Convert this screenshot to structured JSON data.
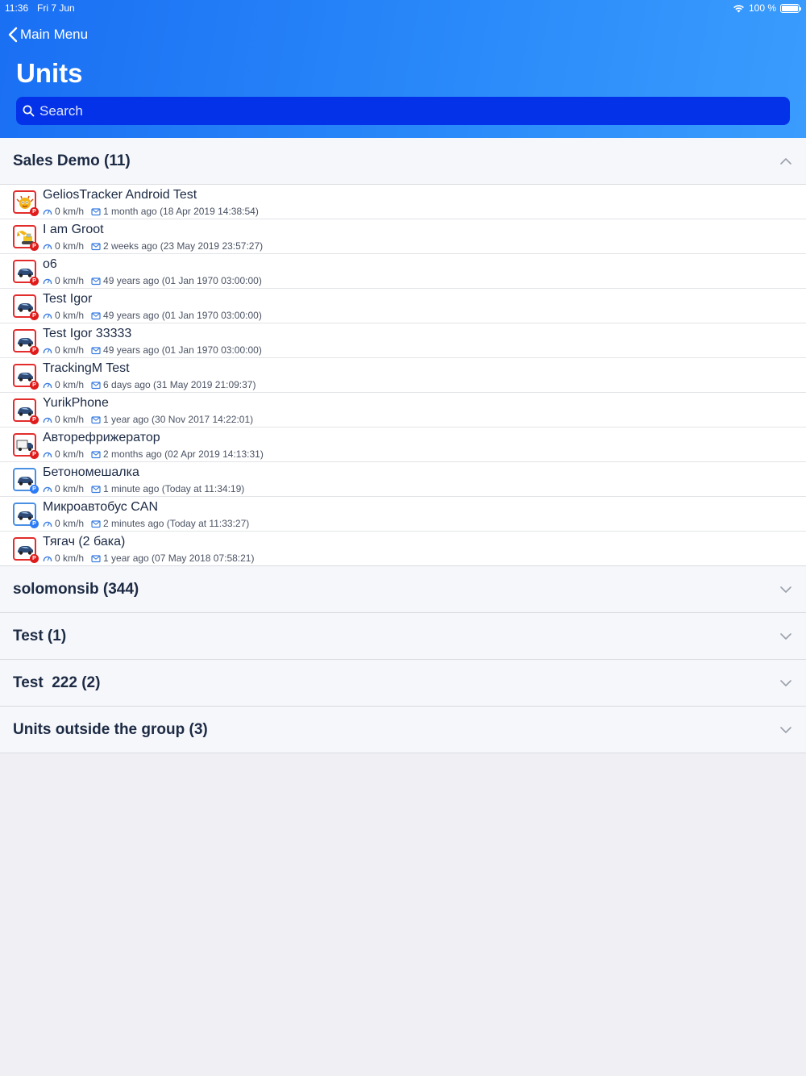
{
  "status": {
    "time": "11:36",
    "date": "Fri 7 Jun",
    "battery": "100 %"
  },
  "nav": {
    "back_label": "Main Menu",
    "title": "Units"
  },
  "search": {
    "placeholder": "Search"
  },
  "colors": {
    "header_start": "#1a6ff3",
    "header_end": "#3a9cfd",
    "search_bg": "#0432e8",
    "red_status": "#e32c2c",
    "blue_status": "#4a90e2"
  },
  "groups": [
    {
      "title": "Sales Demo (11)",
      "expanded": true
    },
    {
      "title": "solomonsib (344)",
      "expanded": false
    },
    {
      "title": "Test (1)",
      "expanded": false
    },
    {
      "title": "Test  222 (2)",
      "expanded": false
    },
    {
      "title": "Units outside the group (3)",
      "expanded": false
    }
  ],
  "units": [
    {
      "name": "GeliosTracker Android Test",
      "speed": "0 km/h",
      "last_msg": "1 month ago (18 Apr 2019 14:38:54)",
      "status": "red",
      "icon": "monster-icon"
    },
    {
      "name": "I am Groot",
      "speed": "0 km/h",
      "last_msg": "2 weeks ago (23 May 2019 23:57:27)",
      "status": "red",
      "icon": "excavator-icon"
    },
    {
      "name": "o6",
      "speed": "0 km/h",
      "last_msg": "49 years ago (01 Jan 1970 03:00:00)",
      "status": "red",
      "icon": "car-icon"
    },
    {
      "name": "Test Igor",
      "speed": "0 km/h",
      "last_msg": "49 years ago (01 Jan 1970 03:00:00)",
      "status": "red",
      "icon": "car-icon"
    },
    {
      "name": "Test Igor 33333",
      "speed": "0 km/h",
      "last_msg": "49 years ago (01 Jan 1970 03:00:00)",
      "status": "red",
      "icon": "car-icon"
    },
    {
      "name": "TrackingM Test",
      "speed": "0 km/h",
      "last_msg": "6 days ago (31 May 2019 21:09:37)",
      "status": "red",
      "icon": "car-icon"
    },
    {
      "name": "YurikPhone",
      "speed": "0 km/h",
      "last_msg": "1 year ago (30 Nov 2017 14:22:01)",
      "status": "red",
      "icon": "car-icon"
    },
    {
      "name": "Авторефрижератор",
      "speed": "0 km/h",
      "last_msg": "2 months ago (02 Apr 2019 14:13:31)",
      "status": "red",
      "icon": "truck-icon"
    },
    {
      "name": "Бетономешалка",
      "speed": "0 km/h",
      "last_msg": "1 minute ago (Today at 11:34:19)",
      "status": "blue",
      "icon": "car-icon"
    },
    {
      "name": "Микроавтобус  CAN",
      "speed": "0 km/h",
      "last_msg": "2 minutes ago (Today at 11:33:27)",
      "status": "blue",
      "icon": "car-icon"
    },
    {
      "name": "Тягач (2 бака)",
      "speed": "0 km/h",
      "last_msg": "1 year ago (07 May 2018 07:58:21)",
      "status": "red",
      "icon": "car-icon"
    }
  ],
  "badge_letter": "P"
}
